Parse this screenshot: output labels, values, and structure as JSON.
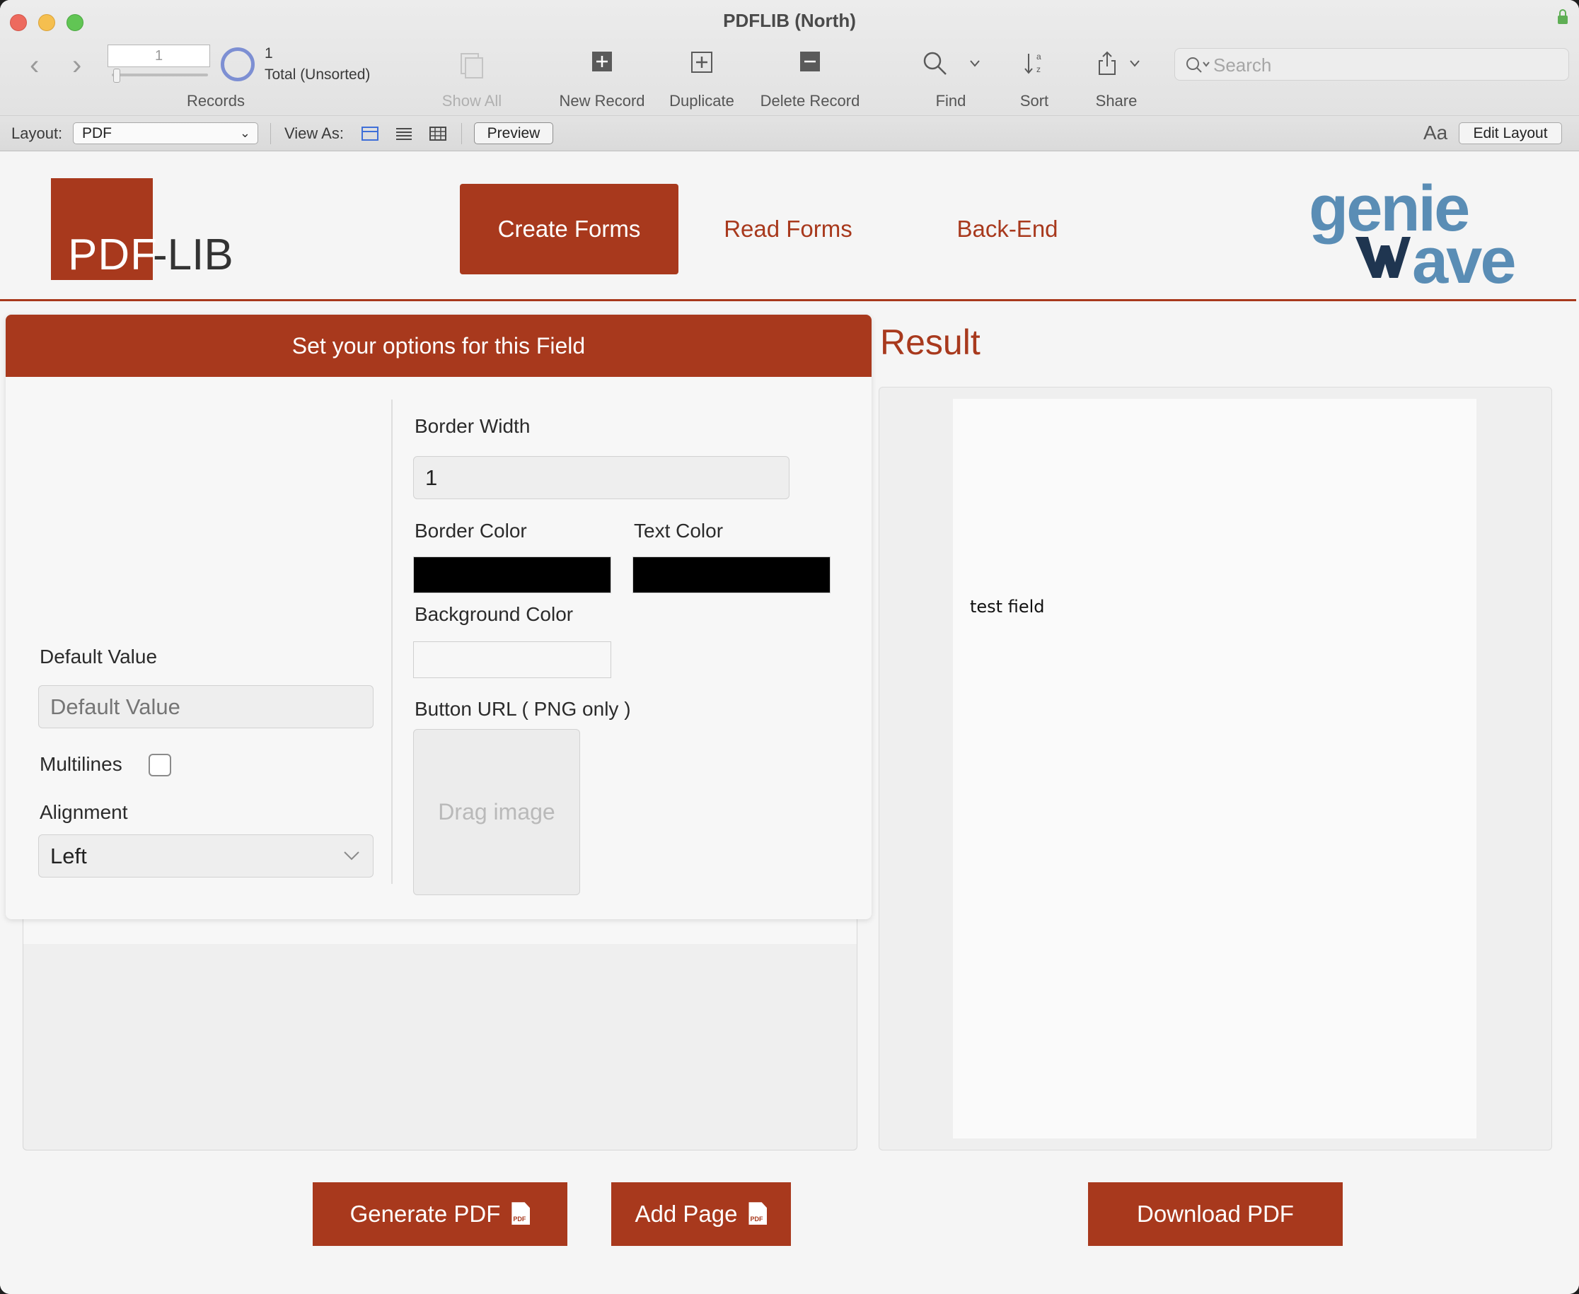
{
  "window": {
    "title": "PDFLIB (North)"
  },
  "toolbar": {
    "record_number": "1",
    "record_count": "1",
    "record_status": "Total (Unsorted)",
    "records_label": "Records",
    "show_all_label": "Show All",
    "new_record_label": "New Record",
    "duplicate_label": "Duplicate",
    "delete_record_label": "Delete Record",
    "find_label": "Find",
    "sort_label": "Sort",
    "share_label": "Share",
    "search_placeholder": "Search"
  },
  "layout_bar": {
    "layout_label": "Layout:",
    "layout_value": "PDF",
    "view_as_label": "View As:",
    "preview_label": "Preview",
    "text_size_label": "Aa",
    "edit_layout_label": "Edit Layout"
  },
  "header": {
    "logo_part1": "PDF",
    "logo_part2": "-LIB",
    "tabs": [
      {
        "label": "Create Forms",
        "active": true
      },
      {
        "label": "Read Forms",
        "active": false
      },
      {
        "label": "Back-End",
        "active": false
      }
    ],
    "brand_line1": "genie",
    "brand_line2": "ave"
  },
  "field_options": {
    "heading": "Set your options for this Field",
    "default_value_label": "Default Value",
    "default_value_placeholder": "Default Value",
    "multilines_label": "Multilines",
    "multilines_checked": false,
    "alignment_label": "Alignment",
    "alignment_value": "Left",
    "border_width_label": "Border Width",
    "border_width_value": "1",
    "border_color_label": "Border Color",
    "border_color": "#000000",
    "text_color_label": "Text Color",
    "text_color": "#000000",
    "background_color_label": "Background Color",
    "background_color": "#f7f7f7",
    "button_url_label": "Button URL ( PNG only )",
    "drag_image_label": "Drag image"
  },
  "result": {
    "title": "Result",
    "preview_text": "test field"
  },
  "actions": {
    "generate_pdf": "Generate PDF",
    "add_page": "Add Page",
    "download_pdf": "Download PDF"
  },
  "colors": {
    "accent": "#a8391d",
    "brand_blue": "#5a8db5",
    "brand_navy": "#1f3550"
  }
}
